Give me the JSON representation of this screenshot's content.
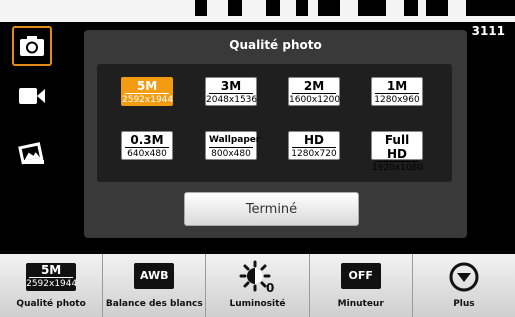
{
  "status": {
    "counter": "3111"
  },
  "modes": [
    {
      "name": "camera",
      "active": true
    },
    {
      "name": "video",
      "active": false
    },
    {
      "name": "gallery",
      "active": false
    }
  ],
  "dialog": {
    "title": "Qualité photo",
    "sizes": [
      {
        "main": "5M",
        "sub": "2592x1944",
        "selected": true
      },
      {
        "main": "3M",
        "sub": "2048x1536",
        "selected": false
      },
      {
        "main": "2M",
        "sub": "1600x1200",
        "selected": false
      },
      {
        "main": "1M",
        "sub": "1280x960",
        "selected": false
      },
      {
        "main": "0.3M",
        "sub": "640x480",
        "selected": false
      },
      {
        "main": "Wallpaper",
        "sub": "800x480",
        "selected": false
      },
      {
        "main": "HD",
        "sub": "1280x720",
        "selected": false
      },
      {
        "main": "Full HD",
        "sub": "1920x1080",
        "selected": false
      }
    ],
    "done_label": "Terminé"
  },
  "toolbar": {
    "items": [
      {
        "label": "Qualité photo",
        "badge_main": "5M",
        "badge_sub": "2592x1944"
      },
      {
        "label": "Balance des blancs",
        "badge": "AWB"
      },
      {
        "label": "Luminosité",
        "icon": "brightness-icon",
        "value": "0"
      },
      {
        "label": "Minuteur",
        "badge": "OFF"
      },
      {
        "label": "Plus",
        "icon": "chevron-down-circle-icon"
      }
    ]
  },
  "colors": {
    "accent": "#f39c12",
    "mode_border": "#e38a1a",
    "dialog_bg": "#393939",
    "grid_bg": "#1f1f1f"
  }
}
